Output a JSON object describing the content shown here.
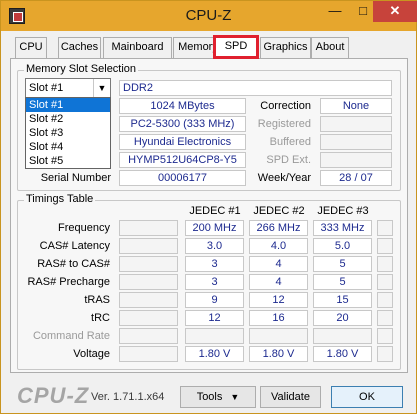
{
  "window": {
    "title": "CPU-Z",
    "min": "—",
    "max": "□",
    "close": "✕"
  },
  "tabs": [
    "CPU",
    "Caches",
    "Mainboard",
    "Memory",
    "SPD",
    "Graphics",
    "About"
  ],
  "memory_slot": {
    "group_title": "Memory Slot Selection",
    "selected": "Slot #1",
    "options": [
      "Slot #1",
      "Slot #2",
      "Slot #3",
      "Slot #4",
      "Slot #5"
    ],
    "type": "DDR2",
    "size": "1024 MBytes",
    "speed": "PC2-5300 (333 MHz)",
    "manufacturer": "Hyundai Electronics",
    "part_number": "HYMP512U64CP8-Y5",
    "serial_label": "Serial Number",
    "serial": "00006177",
    "correction_label": "Correction",
    "correction": "None",
    "registered_label": "Registered",
    "registered": "",
    "buffered_label": "Buffered",
    "buffered": "",
    "spd_ext_label": "SPD Ext.",
    "spd_ext": "",
    "weekyear_label": "Week/Year",
    "weekyear": "28 / 07"
  },
  "timings": {
    "group_title": "Timings Table",
    "columns": [
      "JEDEC #1",
      "JEDEC #2",
      "JEDEC #3"
    ],
    "rows": [
      {
        "label": "Frequency",
        "values": [
          "200 MHz",
          "266 MHz",
          "333 MHz"
        ],
        "dim": false
      },
      {
        "label": "CAS# Latency",
        "values": [
          "3.0",
          "4.0",
          "5.0"
        ],
        "dim": false
      },
      {
        "label": "RAS# to CAS#",
        "values": [
          "3",
          "4",
          "5"
        ],
        "dim": false
      },
      {
        "label": "RAS# Precharge",
        "values": [
          "3",
          "4",
          "5"
        ],
        "dim": false
      },
      {
        "label": "tRAS",
        "values": [
          "9",
          "12",
          "15"
        ],
        "dim": false
      },
      {
        "label": "tRC",
        "values": [
          "12",
          "16",
          "20"
        ],
        "dim": false
      },
      {
        "label": "Command Rate",
        "values": [
          "",
          "",
          ""
        ],
        "dim": true
      },
      {
        "label": "Voltage",
        "values": [
          "1.80 V",
          "1.80 V",
          "1.80 V"
        ],
        "dim": false
      }
    ]
  },
  "footer": {
    "logo": "CPU-Z",
    "version": "Ver. 1.71.1.x64",
    "tools_label": "Tools",
    "validate_label": "Validate",
    "ok_label": "OK"
  }
}
